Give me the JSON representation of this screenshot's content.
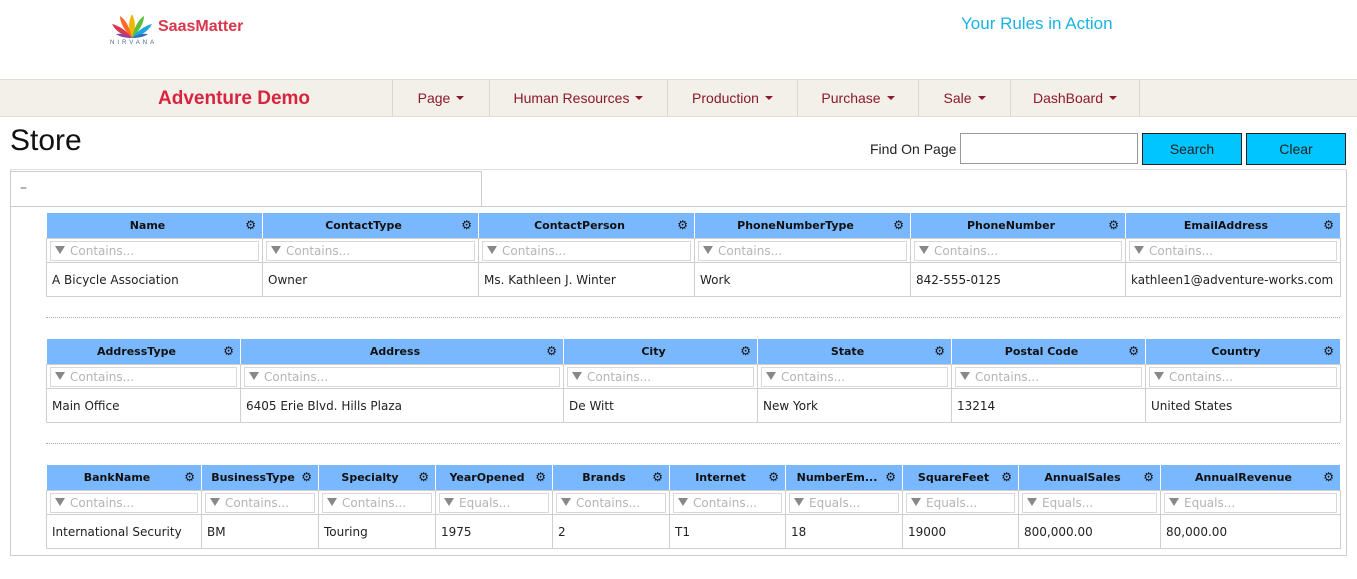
{
  "brand": {
    "name": "SaasMatter",
    "sub": "NIRVANA",
    "tagline": "Your Rules in Action"
  },
  "nav": {
    "app_title": "Adventure Demo",
    "menus": [
      "Page",
      "Human Resources",
      "Production",
      "Purchase",
      "Sale",
      "DashBoard"
    ]
  },
  "page": {
    "title": "Store"
  },
  "find": {
    "label": "Find On Page",
    "value": "",
    "search_label": "Search",
    "clear_label": "Clear"
  },
  "panel": {
    "toggle": "–"
  },
  "grid1": {
    "columns": [
      {
        "label": "Name",
        "filter": "Contains..."
      },
      {
        "label": "ContactType",
        "filter": "Contains..."
      },
      {
        "label": "ContactPerson",
        "filter": "Contains..."
      },
      {
        "label": "PhoneNumberType",
        "filter": "Contains..."
      },
      {
        "label": "PhoneNumber",
        "filter": "Contains..."
      },
      {
        "label": "EmailAddress",
        "filter": "Contains..."
      }
    ],
    "rows": [
      [
        "A Bicycle Association",
        "Owner",
        "Ms. Kathleen J. Winter",
        "Work",
        "842-555-0125",
        "kathleen1@adventure-works.com"
      ]
    ]
  },
  "grid2": {
    "columns": [
      {
        "label": "AddressType",
        "filter": "Contains..."
      },
      {
        "label": "Address",
        "filter": "Contains..."
      },
      {
        "label": "City",
        "filter": "Contains..."
      },
      {
        "label": "State",
        "filter": "Contains..."
      },
      {
        "label": "Postal Code",
        "filter": "Contains..."
      },
      {
        "label": "Country",
        "filter": "Contains..."
      }
    ],
    "rows": [
      [
        "Main Office",
        "6405 Erie Blvd. Hills Plaza",
        "De Witt",
        "New York",
        "13214",
        "United States"
      ]
    ]
  },
  "grid3": {
    "columns": [
      {
        "label": "BankName",
        "filter": "Contains..."
      },
      {
        "label": "BusinessType",
        "filter": "Contains..."
      },
      {
        "label": "Specialty",
        "filter": "Contains..."
      },
      {
        "label": "YearOpened",
        "filter": "Equals..."
      },
      {
        "label": "Brands",
        "filter": "Contains..."
      },
      {
        "label": "Internet",
        "filter": "Contains..."
      },
      {
        "label": "NumberEm...",
        "filter": "Equals..."
      },
      {
        "label": "SquareFeet",
        "filter": "Equals..."
      },
      {
        "label": "AnnualSales",
        "filter": "Equals..."
      },
      {
        "label": "AnnualRevenue",
        "filter": "Equals..."
      }
    ],
    "rows": [
      [
        "International Security",
        "BM",
        "Touring",
        "1975",
        "2",
        "T1",
        "18",
        "19000",
        "800,000.00",
        "80,000.00"
      ]
    ]
  },
  "icons": {
    "settings": "gear-icon",
    "filter": "filter-icon",
    "menu_caret": "caret-down-icon"
  },
  "colors": {
    "header_bg": "#79b8ff",
    "button_bg": "#00c5ff",
    "app_title": "#d9243f",
    "tagline": "#19b3e6",
    "brand": "#d9374b"
  }
}
